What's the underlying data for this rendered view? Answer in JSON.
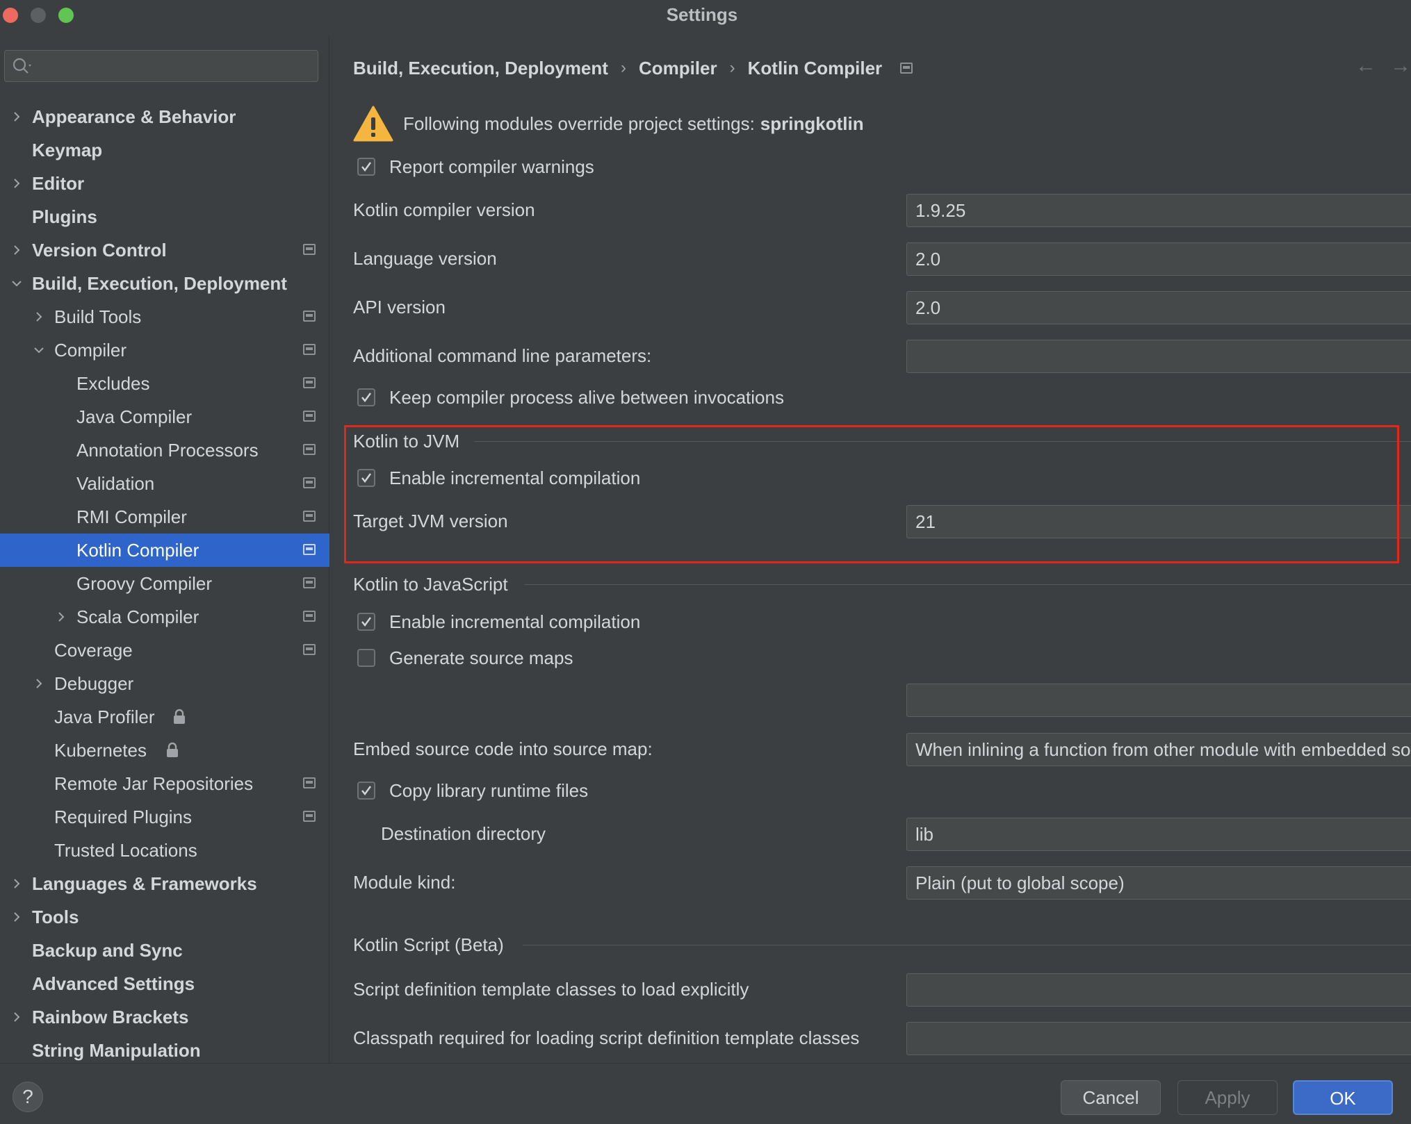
{
  "window": {
    "title": "Settings"
  },
  "search": {
    "placeholder": ""
  },
  "sidebar": {
    "items": [
      {
        "label": "Appearance & Behavior"
      },
      {
        "label": "Keymap"
      },
      {
        "label": "Editor"
      },
      {
        "label": "Plugins"
      },
      {
        "label": "Version Control"
      },
      {
        "label": "Build, Execution, Deployment"
      },
      {
        "label": "Build Tools"
      },
      {
        "label": "Compiler"
      },
      {
        "label": "Excludes"
      },
      {
        "label": "Java Compiler"
      },
      {
        "label": "Annotation Processors"
      },
      {
        "label": "Validation"
      },
      {
        "label": "RMI Compiler"
      },
      {
        "label": "Kotlin Compiler"
      },
      {
        "label": "Groovy Compiler"
      },
      {
        "label": "Scala Compiler"
      },
      {
        "label": "Coverage"
      },
      {
        "label": "Debugger"
      },
      {
        "label": "Java Profiler"
      },
      {
        "label": "Kubernetes"
      },
      {
        "label": "Remote Jar Repositories"
      },
      {
        "label": "Required Plugins"
      },
      {
        "label": "Trusted Locations"
      },
      {
        "label": "Languages & Frameworks"
      },
      {
        "label": "Tools"
      },
      {
        "label": "Backup and Sync"
      },
      {
        "label": "Advanced Settings"
      },
      {
        "label": "Rainbow Brackets"
      },
      {
        "label": "String Manipulation"
      }
    ]
  },
  "breadcrumb": {
    "items": [
      "Build, Execution, Deployment",
      "Compiler",
      "Kotlin Compiler"
    ],
    "separator": "›",
    "back": "←",
    "forward": "→"
  },
  "warning": {
    "text": "Following modules override project settings: ",
    "module": "springkotlin"
  },
  "general": {
    "report_warnings": {
      "label": "Report compiler warnings",
      "checked": true
    },
    "compiler_version": {
      "label": "Kotlin compiler version",
      "value": "1.9.25"
    },
    "language_version": {
      "label": "Language version",
      "value": "2.0"
    },
    "api_version": {
      "label": "API version",
      "value": "2.0"
    },
    "additional_params": {
      "label": "Additional command line parameters:",
      "value": ""
    },
    "keep_alive": {
      "label": "Keep compiler process alive between invocations",
      "checked": true
    }
  },
  "jvm": {
    "title": "Kotlin to JVM",
    "incremental": {
      "label": "Enable incremental compilation",
      "checked": true
    },
    "target": {
      "label": "Target JVM version",
      "value": "21"
    }
  },
  "js": {
    "title": "Kotlin to JavaScript",
    "incremental": {
      "label": "Enable incremental compilation",
      "checked": true
    },
    "source_maps": {
      "label": "Generate source maps",
      "checked": false
    },
    "source_map_prefix": {
      "value": ""
    },
    "embed": {
      "label": "Embed source code into source map:",
      "value": "When inlining a function from other module with embedded sources"
    },
    "copy_runtime": {
      "label": "Copy library runtime files",
      "checked": true
    },
    "destination": {
      "label": "Destination directory",
      "value": "lib"
    },
    "module_kind": {
      "label": "Module kind:",
      "value": "Plain (put to global scope)"
    }
  },
  "script": {
    "title": "Kotlin Script (Beta)",
    "template_classes": {
      "label": "Script definition template classes to load explicitly",
      "value": ""
    },
    "classpath": {
      "label": "Classpath required for loading script definition template classes",
      "value": ""
    }
  },
  "footer": {
    "help": "?",
    "cancel": "Cancel",
    "apply": "Apply",
    "ok": "OK"
  },
  "colors": {
    "selection": "#2f65ca",
    "highlight_box": "#e0271b",
    "warning_icon": "#f4b63f"
  }
}
